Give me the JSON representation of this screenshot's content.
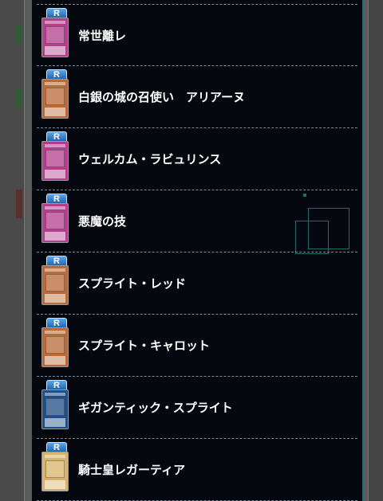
{
  "cards": [
    {
      "rarity": "R",
      "name": "常世離レ",
      "frame": "trap"
    },
    {
      "rarity": "R",
      "name": "白銀の城の召使い　アリアーヌ",
      "frame": "effect"
    },
    {
      "rarity": "R",
      "name": "ウェルカム・ラビュリンス",
      "frame": "trap"
    },
    {
      "rarity": "R",
      "name": "悪魔の技",
      "frame": "trap"
    },
    {
      "rarity": "R",
      "name": "スプライト・レッド",
      "frame": "effect"
    },
    {
      "rarity": "R",
      "name": "スプライト・キャロット",
      "frame": "effect"
    },
    {
      "rarity": "R",
      "name": "ギガンティック・スプライト",
      "frame": "link"
    },
    {
      "rarity": "R",
      "name": "騎士皇レガーティア",
      "frame": "normal"
    }
  ],
  "colors": {
    "list_bg": "#05090f",
    "divider": "#7d8a94",
    "rarity_badge": "#1f5fae",
    "text": "#ffffff"
  }
}
